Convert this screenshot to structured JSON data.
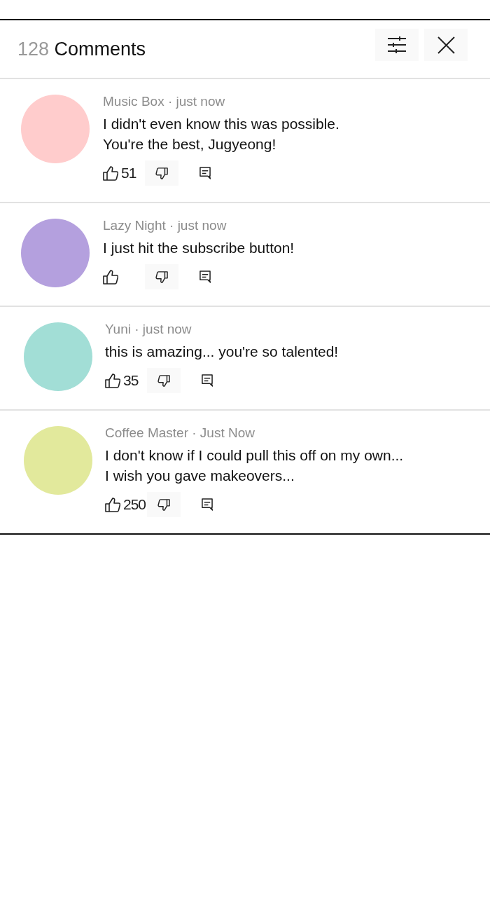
{
  "header": {
    "count": "128",
    "title": "Comments"
  },
  "comments": [
    {
      "byline": "Music Box · just now",
      "text": "I didn't even know this was possible.\nYou're the best, Jugyeong!",
      "likes": "51",
      "color": "#ffcccc"
    },
    {
      "byline": "Lazy Night · just now",
      "text": "I just hit the subscribe button!",
      "color": "#b4a0de"
    },
    {
      "byline": "Yuni · just now",
      "text": "this is amazing... you're so talented!",
      "likes": "35",
      "color": "#a2ded6"
    },
    {
      "byline": "Coffee Master · Just Now",
      "text": "I don't know if I could pull this off on my own...\nI wish you gave makeovers...",
      "likes": "250",
      "color": "#e2e99c"
    }
  ]
}
